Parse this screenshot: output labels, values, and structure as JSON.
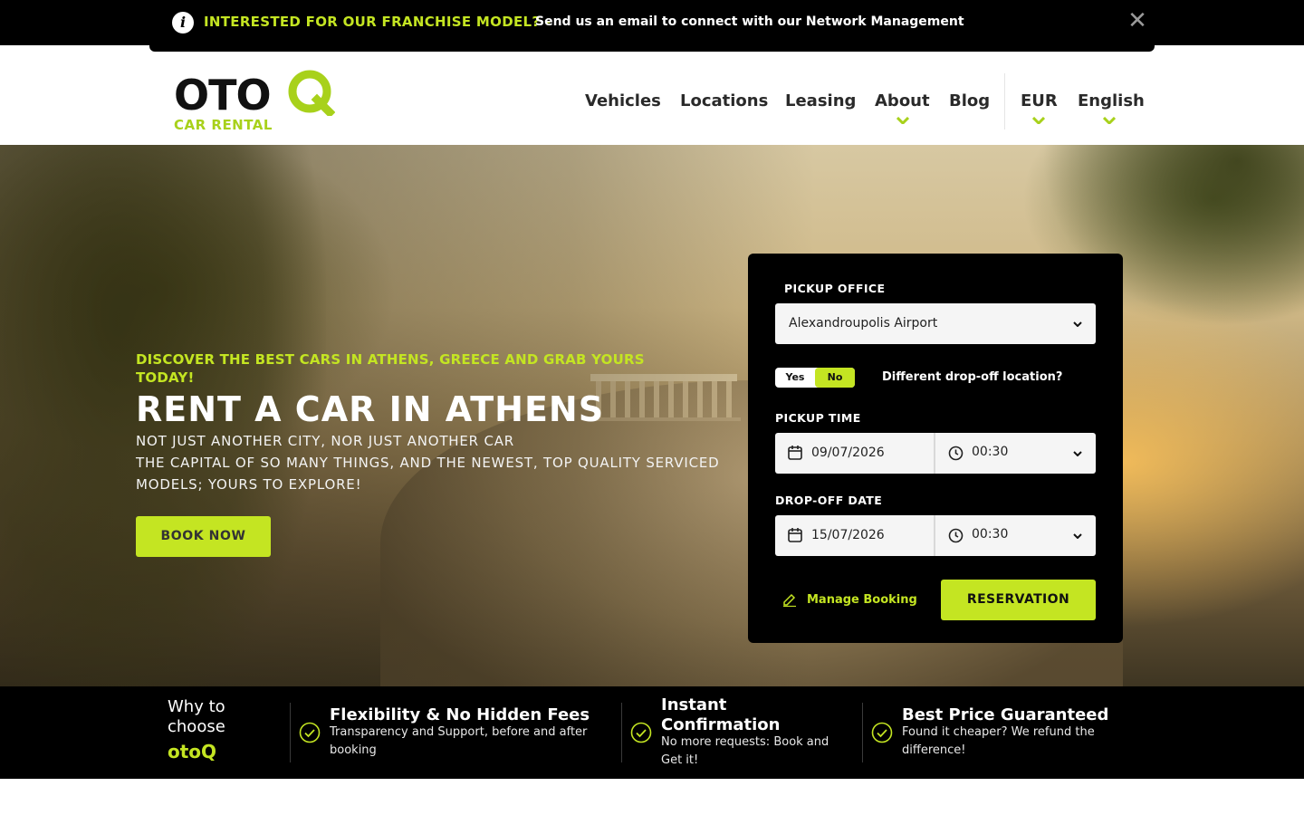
{
  "announcement": {
    "info_icon": "info-icon",
    "title": "INTERESTED FOR OUR FRANCHISE MODEL? -",
    "text": "Send us an email to connect with our Network Management",
    "close_icon": "close-icon"
  },
  "logo": {
    "main": "OTO",
    "sub": "CAR RENTAL"
  },
  "nav": {
    "items": [
      {
        "label": "Vehicles",
        "has_dropdown": false
      },
      {
        "label": "Locations",
        "has_dropdown": false
      },
      {
        "label": "Leasing",
        "has_dropdown": false
      },
      {
        "label": "About",
        "has_dropdown": true
      },
      {
        "label": "Blog",
        "has_dropdown": false
      }
    ],
    "currency": "EUR",
    "language": "English"
  },
  "hero": {
    "kicker": "DISCOVER THE BEST CARS IN ATHENS, GREECE AND GRAB YOURS TODAY!",
    "title": "RENT A CAR IN ATHENS",
    "subtitle_line1": "NOT JUST ANOTHER CITY, NOR JUST ANOTHER CAR",
    "subtitle_line2": "THE CAPITAL OF SO MANY THINGS, AND THE NEWEST, TOP QUALITY SERVICED MODELS; YOURS TO EXPLORE!",
    "cta": "BOOK NOW"
  },
  "booking": {
    "pickup_office_label": "PICKUP OFFICE",
    "pickup_office_value": "Alexandroupolis Airport",
    "toggle_yes": "Yes",
    "toggle_no": "No",
    "toggle_selected": "No",
    "different_dropoff_label": "Different drop-off location?",
    "pickup_time_label": "PICKUP TIME",
    "pickup_date": "09/07/2026",
    "pickup_time": "00:30",
    "dropoff_date_label": "DROP-OFF DATE",
    "dropoff_date": "15/07/2026",
    "dropoff_time": "00:30",
    "manage_booking": "Manage Booking",
    "reservation": "RESERVATION"
  },
  "why": {
    "title": "Why to choose",
    "brand": "otoQ",
    "features": [
      {
        "title": "Flexibility & No Hidden Fees",
        "text": "Transparency and Support, before and after booking"
      },
      {
        "title": "Instant Confirmation",
        "text": "No more requests: Book and Get it!"
      },
      {
        "title": "Best Price Guaranteed",
        "text": "Found it cheaper? We refund the difference!"
      }
    ]
  },
  "colors": {
    "accent": "#c4e522",
    "dark": "#000000",
    "text": "#2a2a2a"
  }
}
